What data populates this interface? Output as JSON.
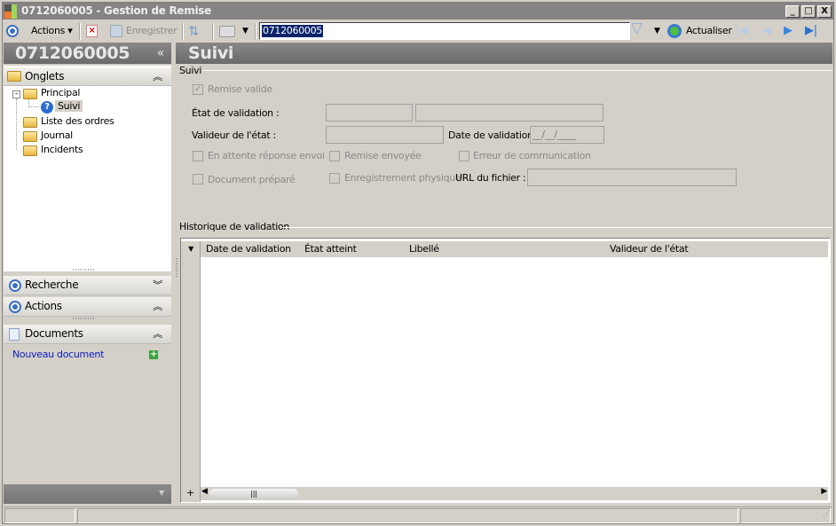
{
  "window": {
    "title": "0712060005 -  Gestion de Remise",
    "min": "_",
    "max": "□",
    "close": "X"
  },
  "toolbar": {
    "actions": "Actions",
    "save": "Enregistrer",
    "search_value": "0712060005",
    "refresh": "Actualiser"
  },
  "left": {
    "header": "0712060005",
    "collapse": "«",
    "onglets": "Onglets",
    "tree": [
      {
        "label": "Principal"
      },
      {
        "label": "Suivi"
      },
      {
        "label": "Liste des ordres"
      },
      {
        "label": "Journal"
      },
      {
        "label": "Incidents"
      }
    ],
    "recherche": "Recherche",
    "actions": "Actions",
    "documents": "Documents",
    "new_doc": "Nouveau document"
  },
  "main": {
    "header": "Suivi",
    "group_suivi": "Suivi",
    "remise_valide": "Remise valide",
    "etat_label": "État de validation :",
    "valideur_label": "Valideur de l'état :",
    "date_label": "Date de validation :",
    "date_value": "__/__/____",
    "cb_attente": "En attente réponse envoi",
    "cb_envoyee": "Remise envoyée",
    "cb_erreur": "Erreur de communication",
    "cb_doc": "Document préparé",
    "cb_enreg": "Enregistrement physique",
    "url_label": "URL du fichier :",
    "group_hist": "Historique de validation",
    "columns": [
      "Date de validation",
      "État atteint",
      "Libellé",
      "Valideur de l'état"
    ]
  }
}
